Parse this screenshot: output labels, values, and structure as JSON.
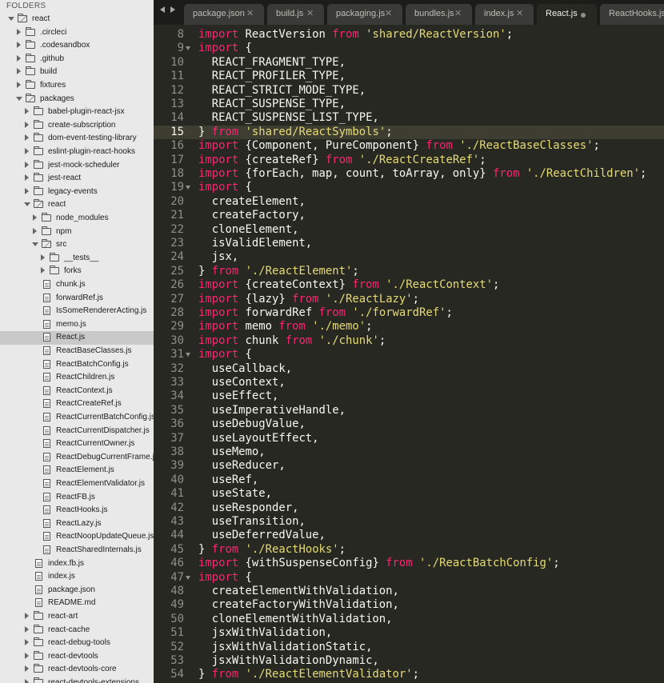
{
  "sidebar": {
    "header": "FOLDERS",
    "items": [
      {
        "label": "react",
        "depth": 0,
        "type": "folder",
        "expanded": true
      },
      {
        "label": ".circleci",
        "depth": 1,
        "type": "folder",
        "expanded": false
      },
      {
        "label": ".codesandbox",
        "depth": 1,
        "type": "folder",
        "expanded": false
      },
      {
        "label": ".github",
        "depth": 1,
        "type": "folder",
        "expanded": false
      },
      {
        "label": "build",
        "depth": 1,
        "type": "folder",
        "expanded": false
      },
      {
        "label": "fixtures",
        "depth": 1,
        "type": "folder",
        "expanded": false
      },
      {
        "label": "packages",
        "depth": 1,
        "type": "folder",
        "expanded": true
      },
      {
        "label": "babel-plugin-react-jsx",
        "depth": 2,
        "type": "folder",
        "expanded": false
      },
      {
        "label": "create-subscription",
        "depth": 2,
        "type": "folder",
        "expanded": false
      },
      {
        "label": "dom-event-testing-library",
        "depth": 2,
        "type": "folder",
        "expanded": false
      },
      {
        "label": "eslint-plugin-react-hooks",
        "depth": 2,
        "type": "folder",
        "expanded": false
      },
      {
        "label": "jest-mock-scheduler",
        "depth": 2,
        "type": "folder",
        "expanded": false
      },
      {
        "label": "jest-react",
        "depth": 2,
        "type": "folder",
        "expanded": false
      },
      {
        "label": "legacy-events",
        "depth": 2,
        "type": "folder",
        "expanded": false
      },
      {
        "label": "react",
        "depth": 2,
        "type": "folder",
        "expanded": true
      },
      {
        "label": "node_modules",
        "depth": 3,
        "type": "folder",
        "expanded": false
      },
      {
        "label": "npm",
        "depth": 3,
        "type": "folder",
        "expanded": false
      },
      {
        "label": "src",
        "depth": 3,
        "type": "folder",
        "expanded": true
      },
      {
        "label": "__tests__",
        "depth": 4,
        "type": "folder",
        "expanded": false
      },
      {
        "label": "forks",
        "depth": 4,
        "type": "folder",
        "expanded": false
      },
      {
        "label": "chunk.js",
        "depth": 4,
        "type": "file"
      },
      {
        "label": "forwardRef.js",
        "depth": 4,
        "type": "file"
      },
      {
        "label": "IsSomeRendererActing.js",
        "depth": 4,
        "type": "file"
      },
      {
        "label": "memo.js",
        "depth": 4,
        "type": "file"
      },
      {
        "label": "React.js",
        "depth": 4,
        "type": "file",
        "selected": true
      },
      {
        "label": "ReactBaseClasses.js",
        "depth": 4,
        "type": "file"
      },
      {
        "label": "ReactBatchConfig.js",
        "depth": 4,
        "type": "file"
      },
      {
        "label": "ReactChildren.js",
        "depth": 4,
        "type": "file"
      },
      {
        "label": "ReactContext.js",
        "depth": 4,
        "type": "file"
      },
      {
        "label": "ReactCreateRef.js",
        "depth": 4,
        "type": "file"
      },
      {
        "label": "ReactCurrentBatchConfig.js",
        "depth": 4,
        "type": "file"
      },
      {
        "label": "ReactCurrentDispatcher.js",
        "depth": 4,
        "type": "file"
      },
      {
        "label": "ReactCurrentOwner.js",
        "depth": 4,
        "type": "file"
      },
      {
        "label": "ReactDebugCurrentFrame.js",
        "depth": 4,
        "type": "file"
      },
      {
        "label": "ReactElement.js",
        "depth": 4,
        "type": "file"
      },
      {
        "label": "ReactElementValidator.js",
        "depth": 4,
        "type": "file"
      },
      {
        "label": "ReactFB.js",
        "depth": 4,
        "type": "file"
      },
      {
        "label": "ReactHooks.js",
        "depth": 4,
        "type": "file"
      },
      {
        "label": "ReactLazy.js",
        "depth": 4,
        "type": "file"
      },
      {
        "label": "ReactNoopUpdateQueue.js",
        "depth": 4,
        "type": "file"
      },
      {
        "label": "ReactSharedInternals.js",
        "depth": 4,
        "type": "file"
      },
      {
        "label": "index.fb.js",
        "depth": 3,
        "type": "file"
      },
      {
        "label": "index.js",
        "depth": 3,
        "type": "file"
      },
      {
        "label": "package.json",
        "depth": 3,
        "type": "file"
      },
      {
        "label": "README.md",
        "depth": 3,
        "type": "file"
      },
      {
        "label": "react-art",
        "depth": 2,
        "type": "folder",
        "expanded": false
      },
      {
        "label": "react-cache",
        "depth": 2,
        "type": "folder",
        "expanded": false
      },
      {
        "label": "react-debug-tools",
        "depth": 2,
        "type": "folder",
        "expanded": false
      },
      {
        "label": "react-devtools",
        "depth": 2,
        "type": "folder",
        "expanded": false
      },
      {
        "label": "react-devtools-core",
        "depth": 2,
        "type": "folder",
        "expanded": false
      },
      {
        "label": "react-devtools-extensions",
        "depth": 2,
        "type": "folder",
        "expanded": false
      }
    ]
  },
  "tabs": [
    {
      "label": "package.json",
      "active": false,
      "dirty": false
    },
    {
      "label": "build.js",
      "active": false,
      "dirty": false
    },
    {
      "label": "packaging.js",
      "active": false,
      "dirty": false
    },
    {
      "label": "bundles.js",
      "active": false,
      "dirty": false
    },
    {
      "label": "index.js",
      "active": false,
      "dirty": false
    },
    {
      "label": "React.js",
      "active": true,
      "dirty": true
    },
    {
      "label": "ReactHooks.js",
      "active": false,
      "dirty": false
    }
  ],
  "tab_close_glyph": "✕",
  "editor": {
    "current_line": "15",
    "lines": [
      {
        "n": "8",
        "fold": false,
        "tokens": [
          {
            "t": "k",
            "v": "import"
          },
          {
            "t": "p",
            "v": " ReactVersion "
          },
          {
            "t": "k",
            "v": "from"
          },
          {
            "t": "p",
            "v": " "
          },
          {
            "t": "s",
            "v": "'shared/ReactVersion'"
          },
          {
            "t": "p",
            "v": ";"
          }
        ]
      },
      {
        "n": "9",
        "fold": true,
        "tokens": [
          {
            "t": "k",
            "v": "import"
          },
          {
            "t": "p",
            "v": " {"
          }
        ]
      },
      {
        "n": "10",
        "fold": false,
        "tokens": [
          {
            "t": "p",
            "v": "  REACT_FRAGMENT_TYPE,"
          }
        ]
      },
      {
        "n": "11",
        "fold": false,
        "tokens": [
          {
            "t": "p",
            "v": "  REACT_PROFILER_TYPE,"
          }
        ]
      },
      {
        "n": "12",
        "fold": false,
        "tokens": [
          {
            "t": "p",
            "v": "  REACT_STRICT_MODE_TYPE,"
          }
        ]
      },
      {
        "n": "13",
        "fold": false,
        "tokens": [
          {
            "t": "p",
            "v": "  REACT_SUSPENSE_TYPE,"
          }
        ]
      },
      {
        "n": "14",
        "fold": false,
        "tokens": [
          {
            "t": "p",
            "v": "  REACT_SUSPENSE_LIST_TYPE,"
          }
        ]
      },
      {
        "n": "15",
        "fold": false,
        "tokens": [
          {
            "t": "p",
            "v": "} "
          },
          {
            "t": "k",
            "v": "from"
          },
          {
            "t": "p",
            "v": " "
          },
          {
            "t": "s",
            "v": "'shared/ReactSymbols'"
          },
          {
            "t": "p",
            "v": ";"
          }
        ]
      },
      {
        "n": "16",
        "fold": false,
        "tokens": [
          {
            "t": "k",
            "v": "import"
          },
          {
            "t": "p",
            "v": " {Component, PureComponent} "
          },
          {
            "t": "k",
            "v": "from"
          },
          {
            "t": "p",
            "v": " "
          },
          {
            "t": "s",
            "v": "'./ReactBaseClasses'"
          },
          {
            "t": "p",
            "v": ";"
          }
        ]
      },
      {
        "n": "17",
        "fold": false,
        "tokens": [
          {
            "t": "k",
            "v": "import"
          },
          {
            "t": "p",
            "v": " {createRef} "
          },
          {
            "t": "k",
            "v": "from"
          },
          {
            "t": "p",
            "v": " "
          },
          {
            "t": "s",
            "v": "'./ReactCreateRef'"
          },
          {
            "t": "p",
            "v": ";"
          }
        ]
      },
      {
        "n": "18",
        "fold": false,
        "tokens": [
          {
            "t": "k",
            "v": "import"
          },
          {
            "t": "p",
            "v": " {forEach, map, count, toArray, only} "
          },
          {
            "t": "k",
            "v": "from"
          },
          {
            "t": "p",
            "v": " "
          },
          {
            "t": "s",
            "v": "'./ReactChildren'"
          },
          {
            "t": "p",
            "v": ";"
          }
        ]
      },
      {
        "n": "19",
        "fold": true,
        "tokens": [
          {
            "t": "k",
            "v": "import"
          },
          {
            "t": "p",
            "v": " {"
          }
        ]
      },
      {
        "n": "20",
        "fold": false,
        "tokens": [
          {
            "t": "p",
            "v": "  createElement,"
          }
        ]
      },
      {
        "n": "21",
        "fold": false,
        "tokens": [
          {
            "t": "p",
            "v": "  createFactory,"
          }
        ]
      },
      {
        "n": "22",
        "fold": false,
        "tokens": [
          {
            "t": "p",
            "v": "  cloneElement,"
          }
        ]
      },
      {
        "n": "23",
        "fold": false,
        "tokens": [
          {
            "t": "p",
            "v": "  isValidElement,"
          }
        ]
      },
      {
        "n": "24",
        "fold": false,
        "tokens": [
          {
            "t": "p",
            "v": "  jsx,"
          }
        ]
      },
      {
        "n": "25",
        "fold": false,
        "tokens": [
          {
            "t": "p",
            "v": "} "
          },
          {
            "t": "k",
            "v": "from"
          },
          {
            "t": "p",
            "v": " "
          },
          {
            "t": "s",
            "v": "'./ReactElement'"
          },
          {
            "t": "p",
            "v": ";"
          }
        ]
      },
      {
        "n": "26",
        "fold": false,
        "tokens": [
          {
            "t": "k",
            "v": "import"
          },
          {
            "t": "p",
            "v": " {createContext} "
          },
          {
            "t": "k",
            "v": "from"
          },
          {
            "t": "p",
            "v": " "
          },
          {
            "t": "s",
            "v": "'./ReactContext'"
          },
          {
            "t": "p",
            "v": ";"
          }
        ]
      },
      {
        "n": "27",
        "fold": false,
        "tokens": [
          {
            "t": "k",
            "v": "import"
          },
          {
            "t": "p",
            "v": " {lazy} "
          },
          {
            "t": "k",
            "v": "from"
          },
          {
            "t": "p",
            "v": " "
          },
          {
            "t": "s",
            "v": "'./ReactLazy'"
          },
          {
            "t": "p",
            "v": ";"
          }
        ]
      },
      {
        "n": "28",
        "fold": false,
        "tokens": [
          {
            "t": "k",
            "v": "import"
          },
          {
            "t": "p",
            "v": " forwardRef "
          },
          {
            "t": "k",
            "v": "from"
          },
          {
            "t": "p",
            "v": " "
          },
          {
            "t": "s",
            "v": "'./forwardRef'"
          },
          {
            "t": "p",
            "v": ";"
          }
        ]
      },
      {
        "n": "29",
        "fold": false,
        "tokens": [
          {
            "t": "k",
            "v": "import"
          },
          {
            "t": "p",
            "v": " memo "
          },
          {
            "t": "k",
            "v": "from"
          },
          {
            "t": "p",
            "v": " "
          },
          {
            "t": "s",
            "v": "'./memo'"
          },
          {
            "t": "p",
            "v": ";"
          }
        ]
      },
      {
        "n": "30",
        "fold": false,
        "tokens": [
          {
            "t": "k",
            "v": "import"
          },
          {
            "t": "p",
            "v": " chunk "
          },
          {
            "t": "k",
            "v": "from"
          },
          {
            "t": "p",
            "v": " "
          },
          {
            "t": "s",
            "v": "'./chunk'"
          },
          {
            "t": "p",
            "v": ";"
          }
        ]
      },
      {
        "n": "31",
        "fold": true,
        "tokens": [
          {
            "t": "k",
            "v": "import"
          },
          {
            "t": "p",
            "v": " {"
          }
        ]
      },
      {
        "n": "32",
        "fold": false,
        "tokens": [
          {
            "t": "p",
            "v": "  useCallback,"
          }
        ]
      },
      {
        "n": "33",
        "fold": false,
        "tokens": [
          {
            "t": "p",
            "v": "  useContext,"
          }
        ]
      },
      {
        "n": "34",
        "fold": false,
        "tokens": [
          {
            "t": "p",
            "v": "  useEffect,"
          }
        ]
      },
      {
        "n": "35",
        "fold": false,
        "tokens": [
          {
            "t": "p",
            "v": "  useImperativeHandle,"
          }
        ]
      },
      {
        "n": "36",
        "fold": false,
        "tokens": [
          {
            "t": "p",
            "v": "  useDebugValue,"
          }
        ]
      },
      {
        "n": "37",
        "fold": false,
        "tokens": [
          {
            "t": "p",
            "v": "  useLayoutEffect,"
          }
        ]
      },
      {
        "n": "38",
        "fold": false,
        "tokens": [
          {
            "t": "p",
            "v": "  useMemo,"
          }
        ]
      },
      {
        "n": "39",
        "fold": false,
        "tokens": [
          {
            "t": "p",
            "v": "  useReducer,"
          }
        ]
      },
      {
        "n": "40",
        "fold": false,
        "tokens": [
          {
            "t": "p",
            "v": "  useRef,"
          }
        ]
      },
      {
        "n": "41",
        "fold": false,
        "tokens": [
          {
            "t": "p",
            "v": "  useState,"
          }
        ]
      },
      {
        "n": "42",
        "fold": false,
        "tokens": [
          {
            "t": "p",
            "v": "  useResponder,"
          }
        ]
      },
      {
        "n": "43",
        "fold": false,
        "tokens": [
          {
            "t": "p",
            "v": "  useTransition,"
          }
        ]
      },
      {
        "n": "44",
        "fold": false,
        "tokens": [
          {
            "t": "p",
            "v": "  useDeferredValue,"
          }
        ]
      },
      {
        "n": "45",
        "fold": false,
        "tokens": [
          {
            "t": "p",
            "v": "} "
          },
          {
            "t": "k",
            "v": "from"
          },
          {
            "t": "p",
            "v": " "
          },
          {
            "t": "s",
            "v": "'./ReactHooks'"
          },
          {
            "t": "p",
            "v": ";"
          }
        ]
      },
      {
        "n": "46",
        "fold": false,
        "tokens": [
          {
            "t": "k",
            "v": "import"
          },
          {
            "t": "p",
            "v": " {withSuspenseConfig} "
          },
          {
            "t": "k",
            "v": "from"
          },
          {
            "t": "p",
            "v": " "
          },
          {
            "t": "s",
            "v": "'./ReactBatchConfig'"
          },
          {
            "t": "p",
            "v": ";"
          }
        ]
      },
      {
        "n": "47",
        "fold": true,
        "tokens": [
          {
            "t": "k",
            "v": "import"
          },
          {
            "t": "p",
            "v": " {"
          }
        ]
      },
      {
        "n": "48",
        "fold": false,
        "tokens": [
          {
            "t": "p",
            "v": "  createElementWithValidation,"
          }
        ]
      },
      {
        "n": "49",
        "fold": false,
        "tokens": [
          {
            "t": "p",
            "v": "  createFactoryWithValidation,"
          }
        ]
      },
      {
        "n": "50",
        "fold": false,
        "tokens": [
          {
            "t": "p",
            "v": "  cloneElementWithValidation,"
          }
        ]
      },
      {
        "n": "51",
        "fold": false,
        "tokens": [
          {
            "t": "p",
            "v": "  jsxWithValidation,"
          }
        ]
      },
      {
        "n": "52",
        "fold": false,
        "tokens": [
          {
            "t": "p",
            "v": "  jsxWithValidationStatic,"
          }
        ]
      },
      {
        "n": "53",
        "fold": false,
        "tokens": [
          {
            "t": "p",
            "v": "  jsxWithValidationDynamic,"
          }
        ]
      },
      {
        "n": "54",
        "fold": false,
        "tokens": [
          {
            "t": "p",
            "v": "} "
          },
          {
            "t": "k",
            "v": "from"
          },
          {
            "t": "p",
            "v": " "
          },
          {
            "t": "s",
            "v": "'./ReactElementValidator'"
          },
          {
            "t": "p",
            "v": ";"
          }
        ]
      }
    ]
  }
}
